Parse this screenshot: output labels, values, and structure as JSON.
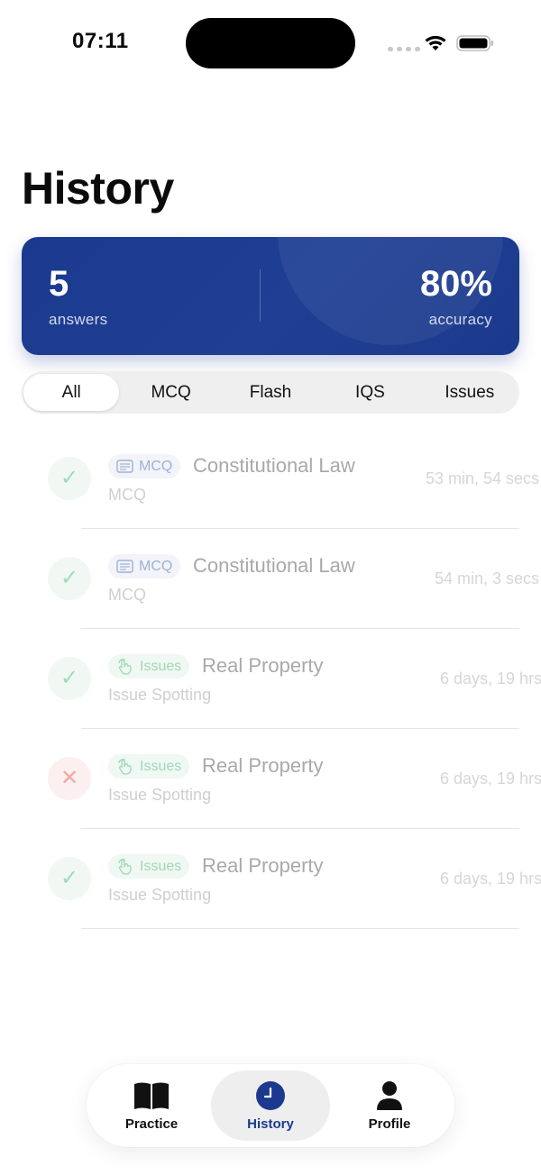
{
  "status_bar": {
    "time": "07:11"
  },
  "header": {
    "title": "History"
  },
  "stats": {
    "answers_value": "5",
    "answers_label": "answers",
    "accuracy_value": "80%",
    "accuracy_label": "accuracy"
  },
  "tabs": [
    {
      "label": "All",
      "active": true
    },
    {
      "label": "MCQ",
      "active": false
    },
    {
      "label": "Flash",
      "active": false
    },
    {
      "label": "IQS",
      "active": false
    },
    {
      "label": "Issues",
      "active": false
    }
  ],
  "history": [
    {
      "result": "correct",
      "chip": "MCQ",
      "chip_icon": "list-icon",
      "title": "Constitutional Law",
      "subtitle": "MCQ",
      "time": "53 min, 54 secs"
    },
    {
      "result": "correct",
      "chip": "MCQ",
      "chip_icon": "list-icon",
      "title": "Constitutional Law",
      "subtitle": "MCQ",
      "time": "54 min, 3 secs"
    },
    {
      "result": "correct",
      "chip": "Issues",
      "chip_icon": "tap-icon",
      "title": "Real Property",
      "subtitle": "Issue Spotting",
      "time": "6 days, 19 hrs"
    },
    {
      "result": "incorrect",
      "chip": "Issues",
      "chip_icon": "tap-icon",
      "title": "Real Property",
      "subtitle": "Issue Spotting",
      "time": "6 days, 19 hrs"
    },
    {
      "result": "correct",
      "chip": "Issues",
      "chip_icon": "tap-icon",
      "title": "Real Property",
      "subtitle": "Issue Spotting",
      "time": "6 days, 19 hrs"
    }
  ],
  "bottom_nav": [
    {
      "label": "Practice",
      "icon": "book-icon",
      "active": false
    },
    {
      "label": "History",
      "icon": "clock-icon",
      "active": true
    },
    {
      "label": "Profile",
      "icon": "person-icon",
      "active": false
    }
  ],
  "colors": {
    "brand": "#1b3a8f",
    "correct": "#9fdcb4",
    "incorrect": "#f2a7a7"
  }
}
